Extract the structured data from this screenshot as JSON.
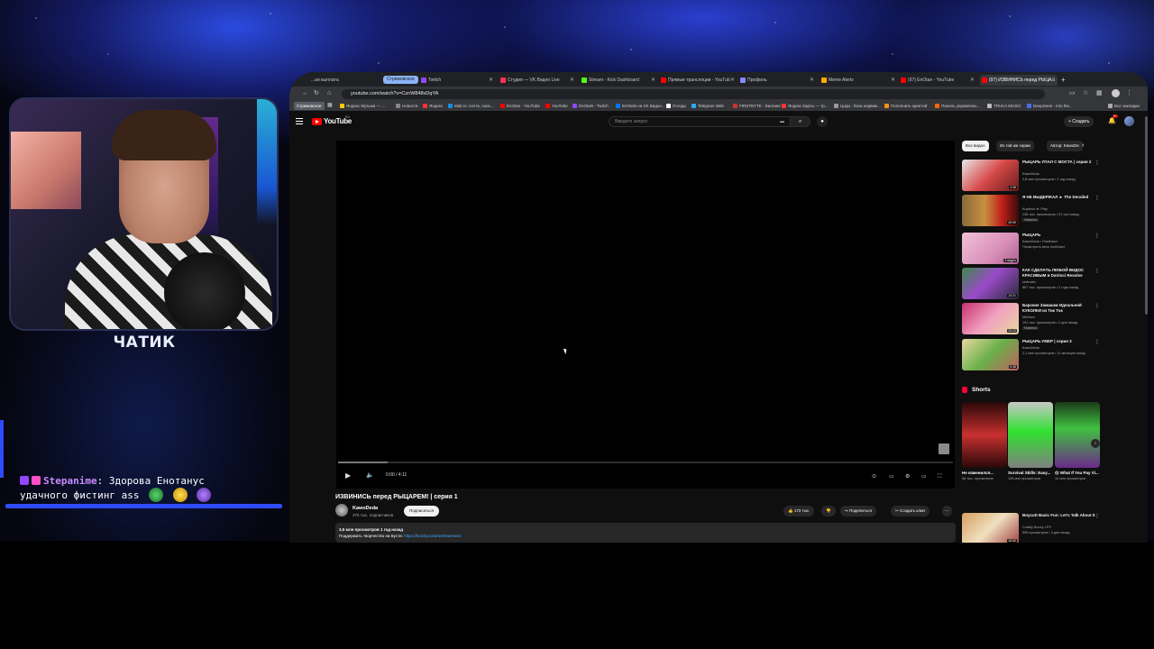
{
  "overlay": {
    "streamer_name": "ЧАТИК",
    "chat": {
      "user": "Stepanime",
      "message_line1": ": Здорова Енотанус",
      "message_line2": "удачного фистинг ass"
    }
  },
  "browser": {
    "tabs": [
      {
        "label": "...ая выплата",
        "color": "#888888"
      },
      {
        "label": "Стримовское",
        "group": true
      },
      {
        "label": "Twitch",
        "color": "#9147ff"
      },
      {
        "label": "Студия — VK Видео Live",
        "color": "#ff3355"
      },
      {
        "label": "Stream - Kick Dashboard",
        "color": "#53fc18"
      },
      {
        "label": "Прямые трансляции - YouTub",
        "color": "#ff0000"
      },
      {
        "label": "Профиль",
        "color": "#8888ff"
      },
      {
        "label": "Meme Alerts",
        "color": "#ffaa00"
      },
      {
        "label": "(97) EnOtan - YouTube",
        "color": "#ff0000"
      },
      {
        "label": "(97) ИЗВИНИСЬ перед РЫЦА...",
        "color": "#ff0000",
        "active": true
      }
    ],
    "new_tab": "+",
    "url": "youtube.com/watch?v=CznW848vDqYA",
    "bookmarks": [
      {
        "label": "Стримовское",
        "group": true
      },
      {
        "label": "Яндекс Музыка — ...",
        "color": "#ffcc00"
      },
      {
        "label": "Новости",
        "color": "#888888"
      },
      {
        "label": "Яндекс",
        "color": "#ff3333"
      },
      {
        "label": "Mail.ru: почта, поис...",
        "color": "#168de2"
      },
      {
        "label": "EnOtan - YouTube",
        "color": "#ff0000"
      },
      {
        "label": "YouTube",
        "color": "#ff0000"
      },
      {
        "label": "EnOtaN - Twitch",
        "color": "#9147ff"
      },
      {
        "label": "EnOtaN на VK Видео...",
        "color": "#0077ff"
      },
      {
        "label": "Погода",
        "color": "#ffffff"
      },
      {
        "label": "Telegram Web",
        "color": "#2aabee"
      },
      {
        "label": "FIRSTBYTE - Биллинг",
        "color": "#cc3333"
      },
      {
        "label": "Яндекс Карты — тр...",
        "color": "#ff3333"
      },
      {
        "label": "Цоди - база недвиж...",
        "color": "#999999"
      },
      {
        "label": "Пополнить криптой",
        "color": "#f7931a"
      },
      {
        "label": "Панель управлени...",
        "color": "#ff6600"
      },
      {
        "label": "TRUKA MUSIC",
        "color": "#bbbbbb"
      },
      {
        "label": "DeepSeek - Into the...",
        "color": "#4d6bfe"
      },
      {
        "label": "Все закладки",
        "color": "#aaaaaa"
      }
    ]
  },
  "youtube": {
    "logo": "YouTube",
    "logo_sup": "RU",
    "search_placeholder": "Введите запрос",
    "create_label": "+ Создать",
    "notif_count": "9+",
    "player": {
      "time": "0:00 / 4:11",
      "progress_buffered": 0.08
    },
    "video": {
      "title": "ИЗВИНИСЬ перед РЫЦАРЕМ! | серия 1",
      "channel": "KawoDeda",
      "subscribers": "376 тыс. подписчиков",
      "subscribe": "Подписаться",
      "likes": "172 тыс.",
      "share": "Поделиться",
      "clip": "Создать клип",
      "views_date": "3,5 млн просмотров  1 год назад",
      "desc_prefix": "Поддержать творчество на Бусти: ",
      "desc_link": "https://boosty.to/iamembarrasss"
    },
    "chips": [
      "Все видео",
      "Из той же серии",
      "Автор: KawoDe"
    ],
    "recommendations": [
      {
        "title": "РЫЦАРЬ УПАЛ С МОСТА | серия 2",
        "channel": "KawoDeda",
        "meta": "2,8 млн просмотров • 1 год назад",
        "duration": "4:38"
      },
      {
        "title": "Я НЕ ВЫДЕРЖАЛ ► The Derailed",
        "channel": "Kuplinov ► Play",
        "meta": "136 тыс. просмотров • 21 час назад",
        "duration": "49:09",
        "badge": "Новинка"
      },
      {
        "title": "РЫЦАРЬ",
        "channel": "KawoDeda • Плейлист",
        "meta": "Посмотреть весь плейлист",
        "duration": "4 видео"
      },
      {
        "title": "КАК СДЕЛАТЬ ЛЮБОЙ ВИДОС КРАСИВЫМ в DaVinci Resolve",
        "channel": "sedrusta",
        "meta": "867 тыс. просмотров • 2 года назад",
        "duration": "13:21"
      },
      {
        "title": "Барские Замашки Идеальной КУКОЛКИ из Тик Ток",
        "channel": "Мейтыч",
        "meta": "191 тыс. просмотров • 2 дня назад",
        "duration": "23:22",
        "badge": "Новинка"
      },
      {
        "title": "РЫЦАРЬ УМЕР | серия 3",
        "channel": "KawoDeda",
        "meta": "2,1 млн просмотров • 11 месяцев назад",
        "duration": "5:38"
      }
    ],
    "shorts_title": "Shorts",
    "shorts": [
      {
        "title": "Не изменился...",
        "views": "68 тыс. просмотров"
      },
      {
        "title": "Survival Skills: Easy...",
        "views": "128 млн просмотров"
      },
      {
        "title": "😱 What If You Pay Vi...",
        "views": "10 млн просмотров"
      }
    ],
    "last_rec": {
      "title": "Boycott Basic Fun: Let's Talk About It",
      "channel": "Cuddly Bunny LPS",
      "meta": "599 просмотров • 3 дня назад",
      "duration": "10:52"
    }
  }
}
